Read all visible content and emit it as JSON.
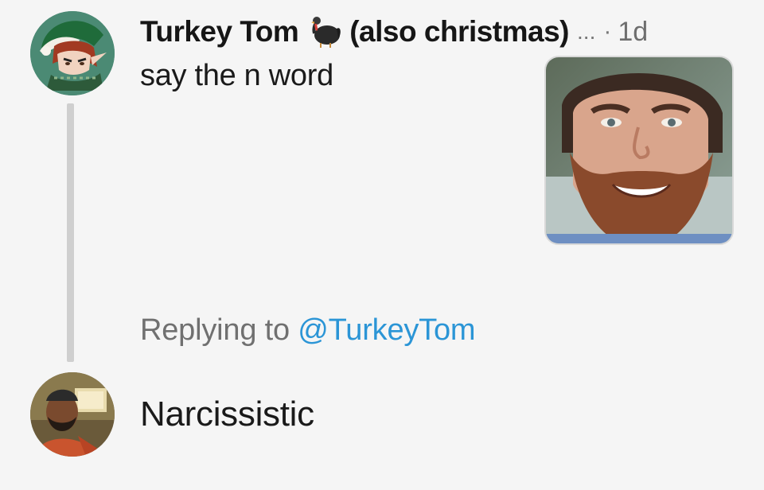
{
  "original_tweet": {
    "display_name": "Turkey Tom",
    "name_emoji_icon": "turkey-icon",
    "name_suffix": "(also christmas)",
    "overflow_menu": "...",
    "separator": "·",
    "timestamp": "1d",
    "text": "say the n word",
    "avatar_icon": "elf-avatar",
    "media": {
      "description_icon": "bearded-man-photo"
    }
  },
  "reply_context": {
    "prefix": "Replying to",
    "mention": "@TurkeyTom",
    "mention_color": "#2b95d6"
  },
  "reply_tweet": {
    "avatar_icon": "user-photo-avatar",
    "text": "Narcissistic"
  },
  "colors": {
    "background": "#f5f5f5",
    "thread_line": "#cfcfcf",
    "muted_text": "#707070"
  }
}
